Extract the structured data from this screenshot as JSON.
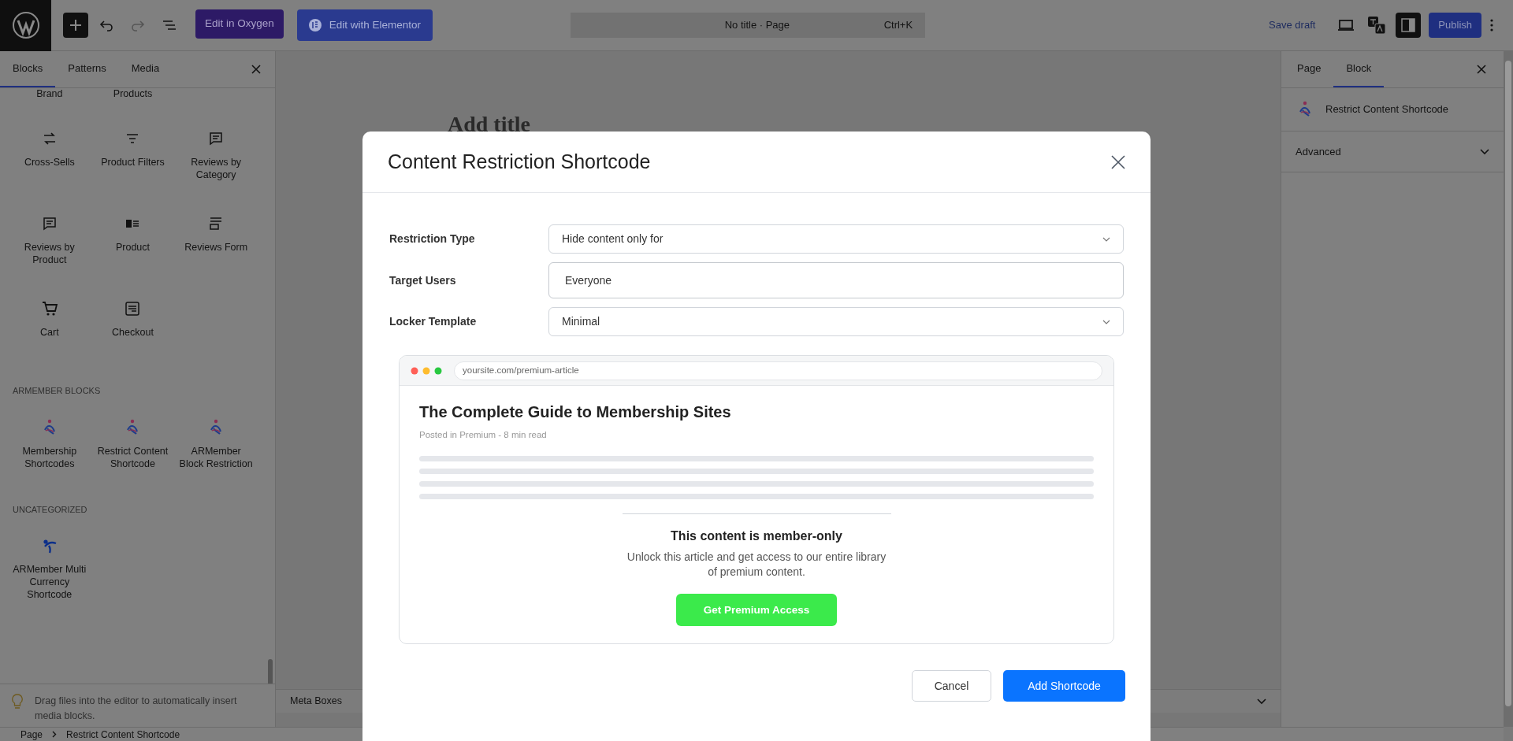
{
  "top_bar": {
    "buttons": [
      {
        "label": "Edit in Oxygen",
        "kind": "oxygen"
      },
      {
        "label": "Edit with Elementor",
        "kind": "elementor"
      }
    ],
    "command": {
      "title": "No title · Page",
      "shortcut": "Ctrl+K"
    },
    "save_draft": "Save draft",
    "publish": "Publish"
  },
  "left_panel": {
    "tabs": [
      {
        "label": "Blocks",
        "selected": true
      },
      {
        "label": "Patterns",
        "selected": false
      },
      {
        "label": "Media",
        "selected": false
      }
    ],
    "cut_row": [
      "Brand",
      "Products"
    ],
    "sections": [
      {
        "items": [
          {
            "label": "Cross-Sells",
            "kind": "cycle"
          },
          {
            "label": "Product Filters",
            "kind": "filter"
          },
          {
            "label": "Reviews by Category",
            "kind": "comment"
          },
          {
            "label": "Reviews by Product",
            "kind": "comment"
          },
          {
            "label": "Product",
            "kind": "media"
          },
          {
            "label": "Reviews Form",
            "kind": "form"
          },
          {
            "label": "Cart",
            "kind": "cart"
          },
          {
            "label": "Checkout",
            "kind": "checkout"
          }
        ]
      },
      {
        "heading": "ARMEMBER BLOCKS",
        "items": [
          {
            "label": "Membership Shortcodes",
            "kind": "armember"
          },
          {
            "label": "Restrict Content Shortcode",
            "kind": "armember"
          },
          {
            "label": "ARMember Block Restriction",
            "kind": "armember"
          }
        ]
      },
      {
        "heading": "UNCATEGORIZED",
        "items": [
          {
            "label": "ARMember Multi Currency Shortcode",
            "kind": "currency"
          }
        ]
      }
    ],
    "tip": "Drag files into the editor to automatically insert media blocks."
  },
  "canvas": {
    "title_placeholder": "Add title",
    "meta_boxes": "Meta Boxes"
  },
  "right_panel": {
    "tabs": [
      {
        "label": "Page",
        "selected": false
      },
      {
        "label": "Block",
        "selected": true
      }
    ],
    "block_name": "Restrict Content Shortcode",
    "section": "Advanced"
  },
  "breadcrumb": [
    "Page",
    "Restrict Content Shortcode"
  ],
  "modal": {
    "title": "Content Restriction Shortcode",
    "fields": [
      {
        "label": "Restriction Type",
        "kind": "select",
        "value": "Hide content only for"
      },
      {
        "label": "Target Users",
        "kind": "input",
        "value": "Everyone"
      },
      {
        "label": "Locker Template",
        "kind": "select",
        "value": "Minimal"
      }
    ],
    "preview": {
      "url": "yoursite.com/premium-article",
      "article_title": "The Complete Guide to Membership Sites",
      "meta": "Posted in Premium - 8 min read",
      "lock_title": "This content is member-only",
      "lock_text": "Unlock this article and get access to our entire library of premium content.",
      "cta": "Get Premium Access"
    },
    "buttons": [
      {
        "label": "Cancel",
        "kind": "secondary"
      },
      {
        "label": "Add Shortcode",
        "kind": "primary"
      }
    ]
  }
}
